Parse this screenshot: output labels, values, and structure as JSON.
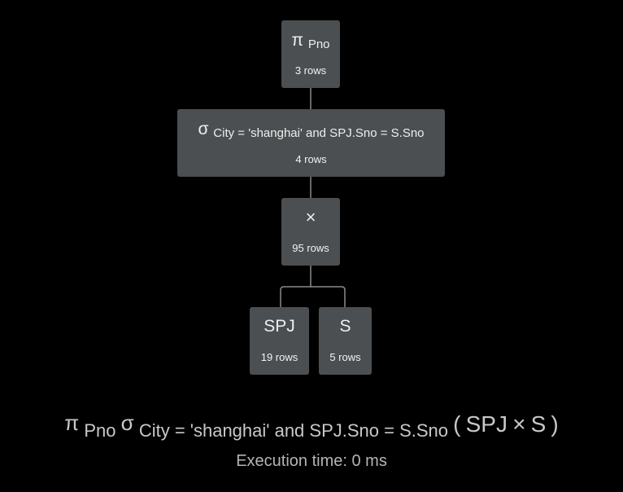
{
  "colors": {
    "background": "#000000",
    "node_fill": "#4b4f51",
    "edge": "#8a8a8a",
    "node_text": "#eeeeee",
    "expression_text": "#c8c8c8"
  },
  "tree": {
    "project": {
      "symbol": "π",
      "subscript": "Pno",
      "rows": "3 rows"
    },
    "select": {
      "symbol": "σ",
      "subscript": "City = 'shanghai' and SPJ.Sno = S.Sno",
      "rows": "4 rows"
    },
    "cross": {
      "symbol": "×",
      "rows": "95 rows"
    },
    "spj": {
      "label": "SPJ",
      "rows": "19 rows"
    },
    "s": {
      "label": "S",
      "rows": "5 rows"
    }
  },
  "expression": {
    "pi": "π",
    "pi_sub": "Pno",
    "sigma": "σ",
    "sigma_sub": "City = 'shanghai' and SPJ.Sno = S.Sno",
    "open_paren": "(",
    "left": "SPJ",
    "times": "×",
    "right": "S",
    "close_paren": ")"
  },
  "execution_time": "Execution time: 0 ms"
}
